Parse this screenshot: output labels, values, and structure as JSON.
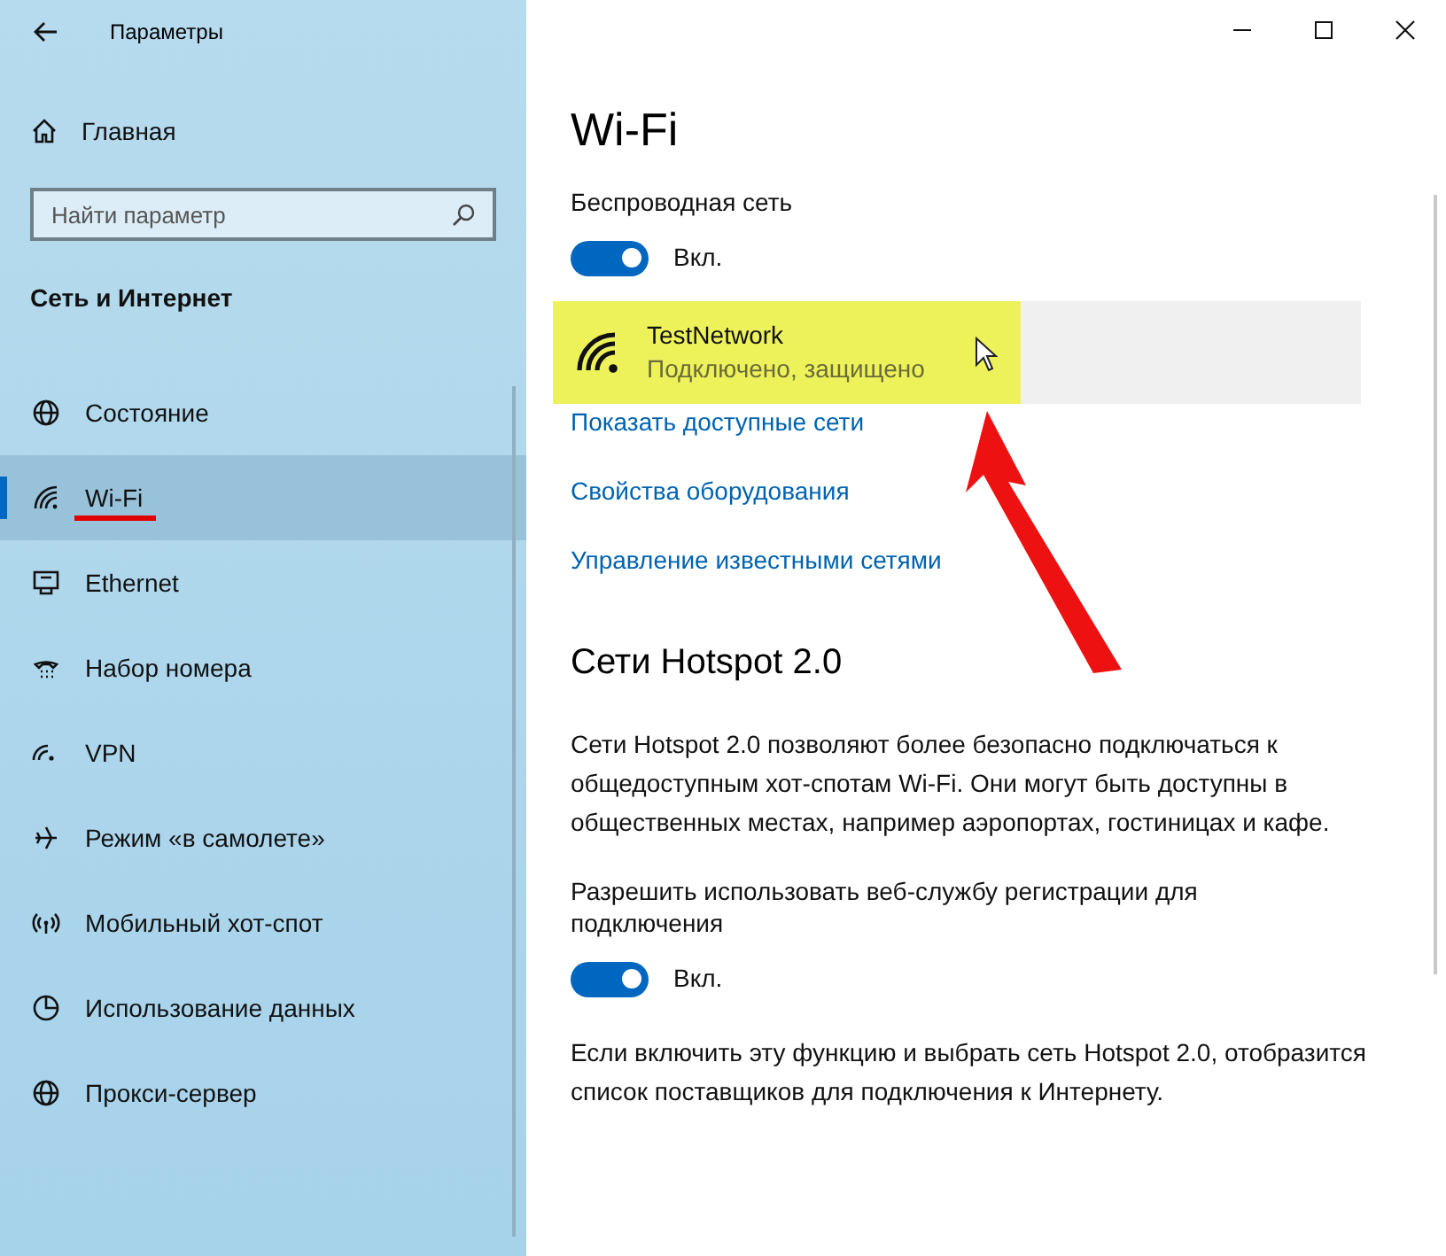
{
  "window": {
    "title": "Параметры"
  },
  "sidebar": {
    "home": "Главная",
    "search": {
      "placeholder": "Найти параметр"
    },
    "section": "Сеть и Интернет",
    "items": [
      {
        "label": "Состояние",
        "selected": false,
        "underlined": false
      },
      {
        "label": "Wi-Fi",
        "selected": true,
        "underlined": true
      },
      {
        "label": "Ethernet",
        "selected": false,
        "underlined": false
      },
      {
        "label": "Набор номера",
        "selected": false,
        "underlined": false
      },
      {
        "label": "VPN",
        "selected": false,
        "underlined": false
      },
      {
        "label": "Режим «в самолете»",
        "selected": false,
        "underlined": false
      },
      {
        "label": "Мобильный хот-спот",
        "selected": false,
        "underlined": false
      },
      {
        "label": "Использование данных",
        "selected": false,
        "underlined": false
      },
      {
        "label": "Прокси-сервер",
        "selected": false,
        "underlined": false
      }
    ]
  },
  "main": {
    "title": "Wi-Fi",
    "wireless": {
      "label": "Беспроводная сеть",
      "on": true,
      "state": "Вкл."
    },
    "network": {
      "name": "TestNetwork",
      "status": "Подключено, защищено",
      "highlighted": true
    },
    "links": [
      "Показать доступные сети",
      "Свойства оборудования",
      "Управление известными сетями"
    ],
    "hotspot_title": "Сети Hotspot 2.0",
    "hotspot_text": "Сети Hotspot 2.0 позволяют более безопасно подключаться к общедоступным хот-спотам Wi-Fi. Они могут быть доступны в общественных местах, например аэропортах, гостиницах и кафе.",
    "registration": {
      "label": "Разрешить использовать веб-службу регистрации для подключения",
      "on": true,
      "state": "Вкл."
    },
    "footer_text": "Если включить эту функцию и выбрать сеть Hotspot 2.0, отобразится список поставщиков для подключения к Интернету."
  }
}
